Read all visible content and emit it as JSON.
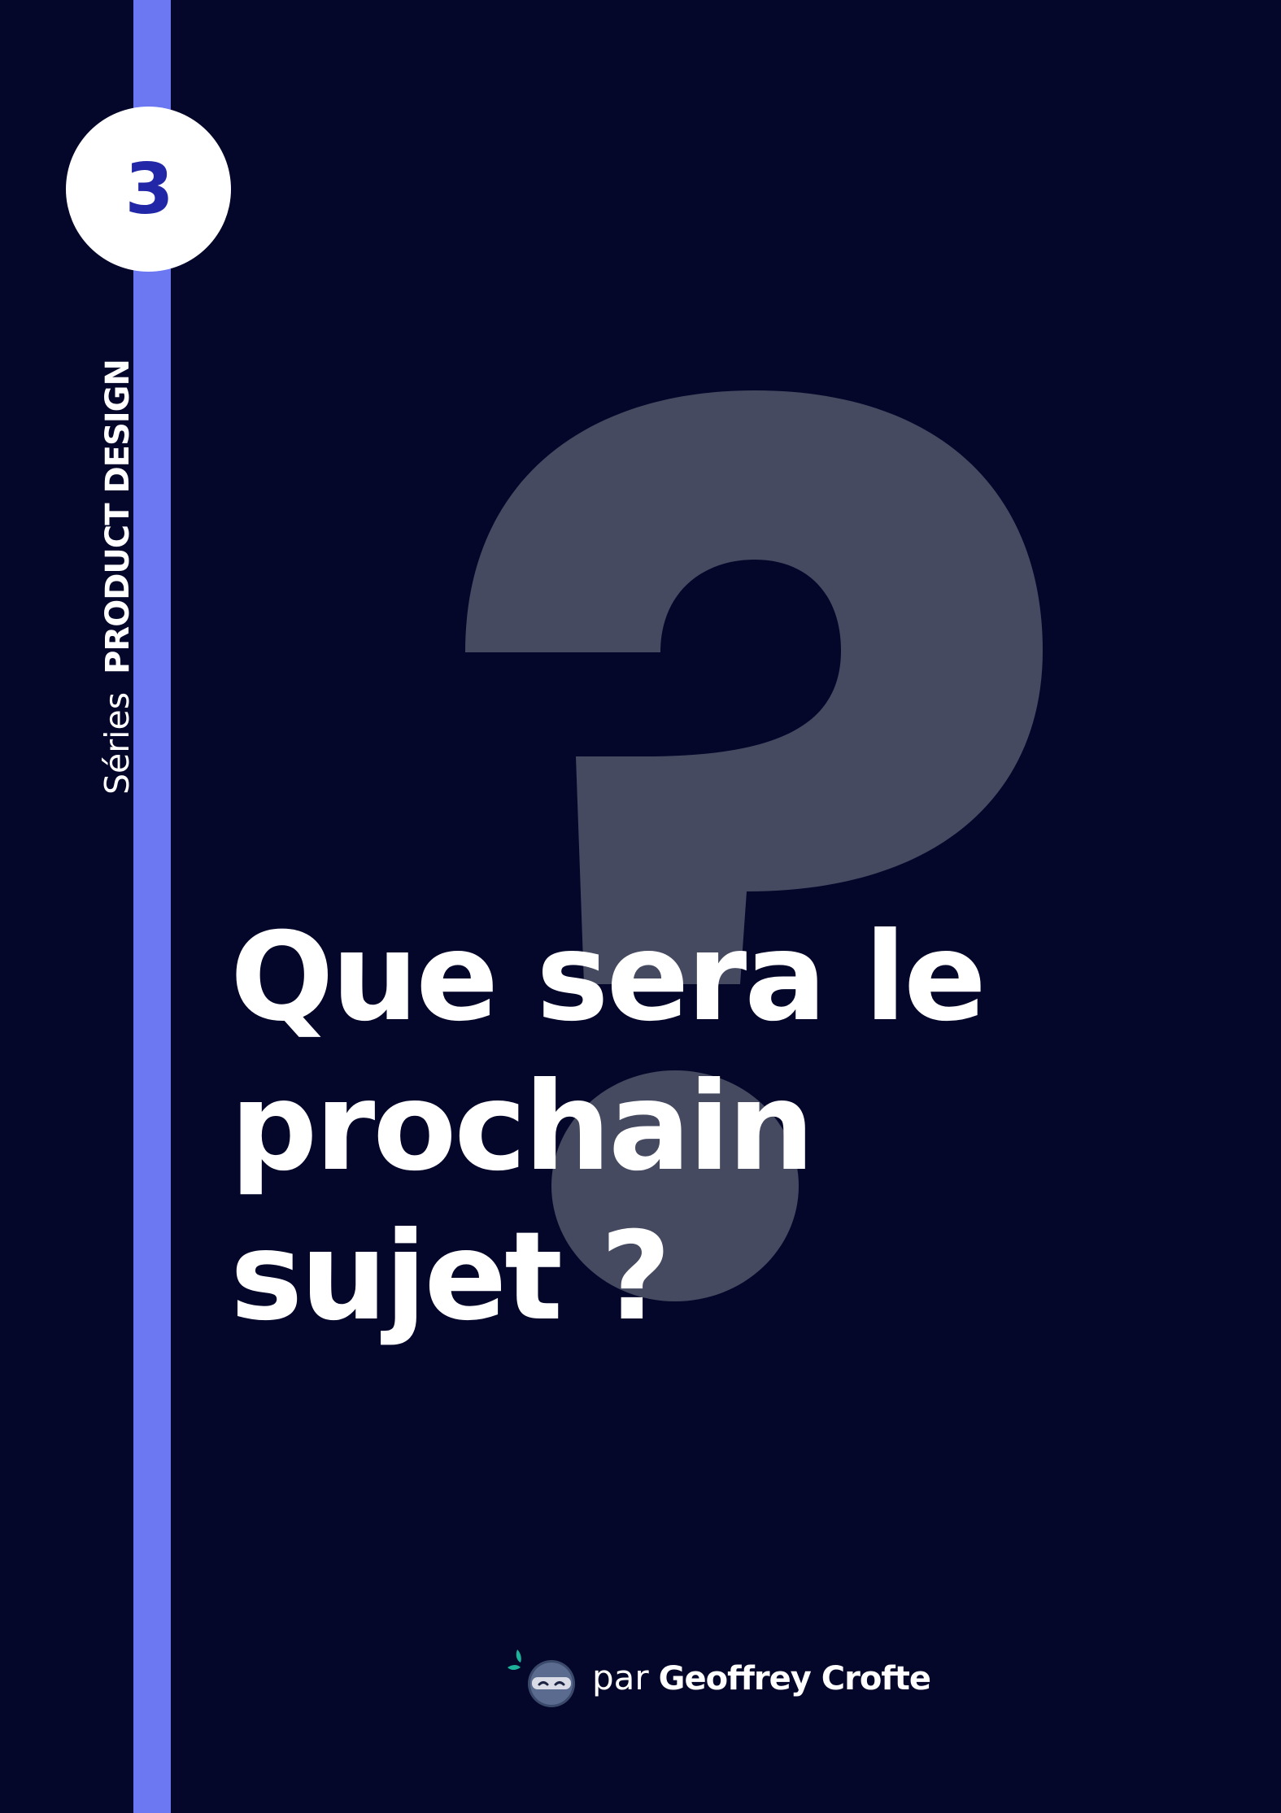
{
  "series": {
    "number": "3",
    "label_prefix": "Séries",
    "label_name": "PRODUCT DESIGN"
  },
  "title": {
    "line1": "Que sera le",
    "line2": "prochain",
    "line3": "sujet ?"
  },
  "footer": {
    "prefix": "par",
    "author": "Geoffrey Crofte"
  },
  "colors": {
    "background": "#05072a",
    "accent": "#6b78f2",
    "number": "#2127a6",
    "question_mark": "#464a60",
    "text": "#ffffff"
  },
  "icons": {
    "big_question": "question-mark-icon",
    "author_avatar": "ninja-avatar-icon"
  }
}
